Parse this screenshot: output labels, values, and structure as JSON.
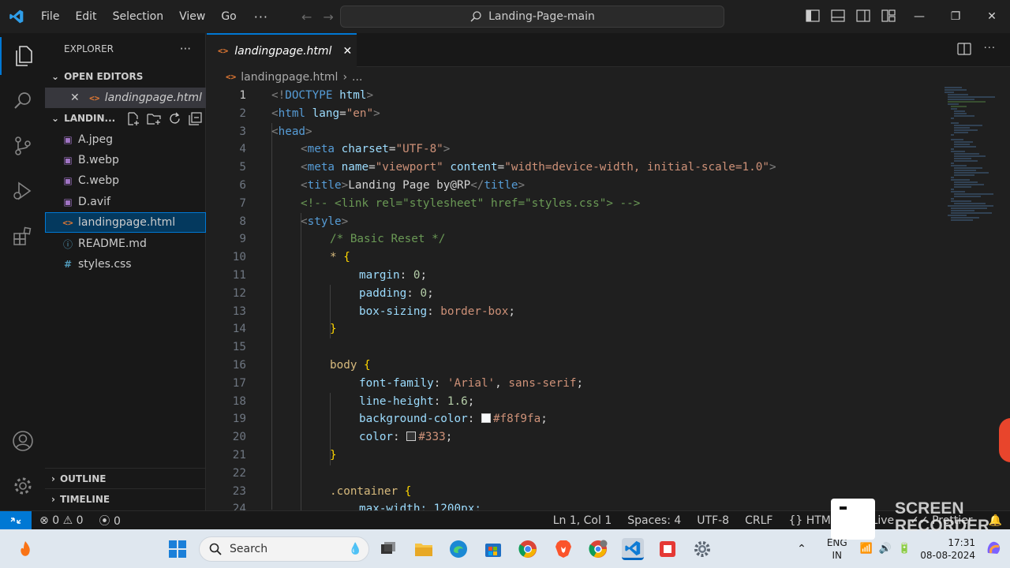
{
  "menu": [
    "File",
    "Edit",
    "Selection",
    "View",
    "Go"
  ],
  "menu_more": "···",
  "command_center": "Landing-Page-main",
  "explorer": {
    "title": "EXPLORER",
    "more": "···",
    "open_editors_label": "OPEN EDITORS",
    "open_editor_file": "landingpage.html",
    "folder_label": "LANDIN...",
    "files": [
      "A.jpeg",
      "B.webp",
      "C.webp",
      "D.avif",
      "landingpage.html",
      "README.md",
      "styles.css"
    ],
    "outline_label": "OUTLINE",
    "timeline_label": "TIMELINE"
  },
  "tab": {
    "label": "landingpage.html"
  },
  "breadcrumb": {
    "file": "landingpage.html",
    "more": "..."
  },
  "code": {
    "l1": [
      "<!",
      "DOCTYPE",
      " ",
      "html",
      ">"
    ],
    "l2_tag": "html",
    "l2_attr": "lang",
    "l2_val": "\"en\"",
    "l3_tag": "head",
    "l4_tag": "meta",
    "l4_attr": "charset",
    "l4_val": "\"UTF-8\"",
    "l5_tag": "meta",
    "l5_attr1": "name",
    "l5_val1": "\"viewport\"",
    "l5_attr2": "content",
    "l5_val2": "\"width=device-width, initial-scale=1.0\"",
    "l6_tag": "title",
    "l6_text": "Landing Page by@RP",
    "l7": "<!-- <link rel=\"stylesheet\" href=\"styles.css\"> -->",
    "l8_tag": "style",
    "l9": "/* Basic Reset */",
    "l10_sel": "*",
    "l11_prop": "margin",
    "l11_val": "0",
    "l12_prop": "padding",
    "l12_val": "0",
    "l13_prop": "box-sizing",
    "l13_val": "border-box",
    "l16_sel": "body",
    "l17_prop": "font-family",
    "l17_val1": "'Arial'",
    "l17_val2": "sans-serif",
    "l18_prop": "line-height",
    "l18_val": "1.6",
    "l19_prop": "background-color",
    "l19_val": "#f8f9fa",
    "l20_prop": "color",
    "l20_val": "#333",
    "l23_sel": ".container",
    "l24_partial": "max-width: 1200px;"
  },
  "line_numbers": [
    "1",
    "2",
    "3",
    "4",
    "5",
    "6",
    "7",
    "8",
    "9",
    "10",
    "11",
    "12",
    "13",
    "14",
    "15",
    "16",
    "17",
    "18",
    "19",
    "20",
    "21",
    "22",
    "23",
    "24"
  ],
  "status": {
    "errors": "0",
    "warnings": "0",
    "ports": "0",
    "position": "Ln 1, Col 1",
    "spaces": "Spaces: 4",
    "encoding": "UTF-8",
    "eol": "CRLF",
    "language": "HTML",
    "live": "Go Live",
    "prettier": "Prettier"
  },
  "taskbar": {
    "search": "Search",
    "lang_top": "ENG",
    "lang_bottom": "IN",
    "time": "17:31",
    "date": "08-08-2024"
  },
  "overlay": {
    "line1": "SCREEN",
    "line2": "RECORDER"
  },
  "colors": {
    "accent": "#0078d4",
    "swatch_bg": "#f8f9fa",
    "swatch_color": "#333333"
  }
}
